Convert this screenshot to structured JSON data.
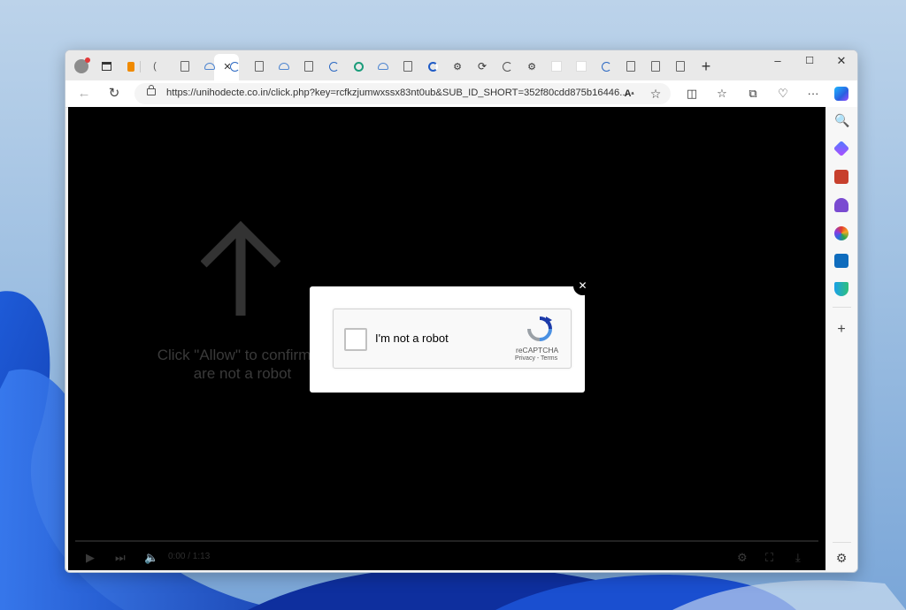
{
  "browser": {
    "url": "https://unihodecte.co.in/click.php?key=rcfkzjumwxssx83nt0ub&SUB_ID_SHORT=352f80cdd875b16446...",
    "new_tab_label": "+",
    "window_controls": {
      "minimize": "–",
      "maximize": "☐",
      "close": "✕"
    },
    "tab_close": "✕"
  },
  "page": {
    "lure_text": "Click \"Allow\" to confirm that you are not a robot",
    "lure_line1": "Click \"Allow\" to confirm th",
    "lure_line2": "are not a robot",
    "video_time": "0:00 / 1:13"
  },
  "modal": {
    "close_label": "✕",
    "captcha_label": "I'm not a robot",
    "recaptcha_name": "reCAPTCHA",
    "recaptcha_links": "Privacy - Terms"
  },
  "colors": {
    "content_background": "#000000",
    "modal_background": "#ffffff",
    "recaptcha_blue": "#1c3aa9",
    "sidebar_copilot": "#1f8ef1"
  },
  "sidebar": {
    "icons": [
      "copilot-icon",
      "search-icon",
      "shopping-tag-icon",
      "tools-briefcase-icon",
      "games-icon",
      "office-icon",
      "outlook-icon",
      "drop-icon",
      "add-icon",
      "settings-icon"
    ]
  }
}
